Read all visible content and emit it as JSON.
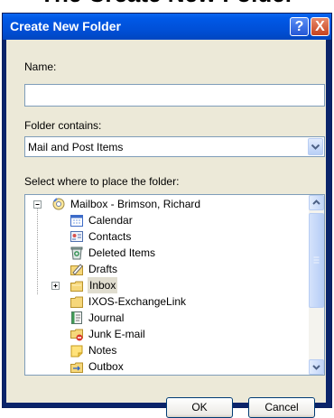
{
  "caption": "The Create New Folder",
  "dialog": {
    "title": "Create New Folder",
    "help_label": "?",
    "close_label": "X",
    "name_label": "Name:",
    "name_value": "",
    "contains_label": "Folder contains:",
    "contains_value": "Mail and Post Items",
    "place_label": "Select where to place the folder:",
    "tree": {
      "root": {
        "label": "Mailbox - Brimson, Richard",
        "icon": "mailbox-icon",
        "expanded": true
      },
      "items": [
        {
          "label": "Calendar",
          "icon": "calendar-icon"
        },
        {
          "label": "Contacts",
          "icon": "contacts-icon"
        },
        {
          "label": "Deleted Items",
          "icon": "deleted-items-icon"
        },
        {
          "label": "Drafts",
          "icon": "drafts-icon"
        },
        {
          "label": "Inbox",
          "icon": "inbox-icon",
          "selected": true,
          "has_children": true
        },
        {
          "label": "IXOS-ExchangeLink",
          "icon": "folder-icon"
        },
        {
          "label": "Journal",
          "icon": "journal-icon"
        },
        {
          "label": "Junk E-mail",
          "icon": "junk-email-icon"
        },
        {
          "label": "Notes",
          "icon": "notes-icon"
        },
        {
          "label": "Outbox",
          "icon": "outbox-icon"
        }
      ]
    },
    "ok_label": "OK",
    "cancel_label": "Cancel"
  }
}
